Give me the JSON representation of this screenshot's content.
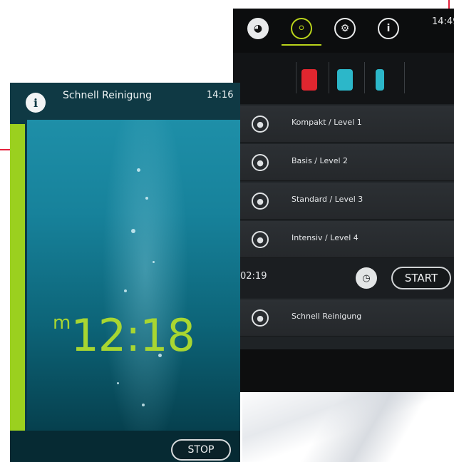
{
  "back_screen": {
    "time": "14:49",
    "nav_icons": [
      "cup-icon",
      "rinse-icon",
      "settings-gears-icon",
      "info-icon"
    ],
    "category_icons": [
      "red-canister-icon",
      "blue-canister-icon",
      "bottle-transfer-icon"
    ],
    "programs": [
      {
        "label": "Kompakt / Level 1"
      },
      {
        "label": "Basis / Level 2"
      },
      {
        "label": "Standard / Level 3"
      },
      {
        "label": "Intensiv / Level 4"
      }
    ],
    "selected_time": "02:19",
    "start_label": "START",
    "quick_program": "Schnell Reinigung"
  },
  "front_screen": {
    "title": "Schnell Reinigung",
    "time": "14:16",
    "timer_unit": "m",
    "timer_value": "12:18",
    "stop_label": "STOP"
  },
  "colors": {
    "accent_green": "#b9d31b",
    "timer_green": "#a8d631",
    "brand_red": "#e4213b",
    "water_blue": "#1e8fa8"
  }
}
